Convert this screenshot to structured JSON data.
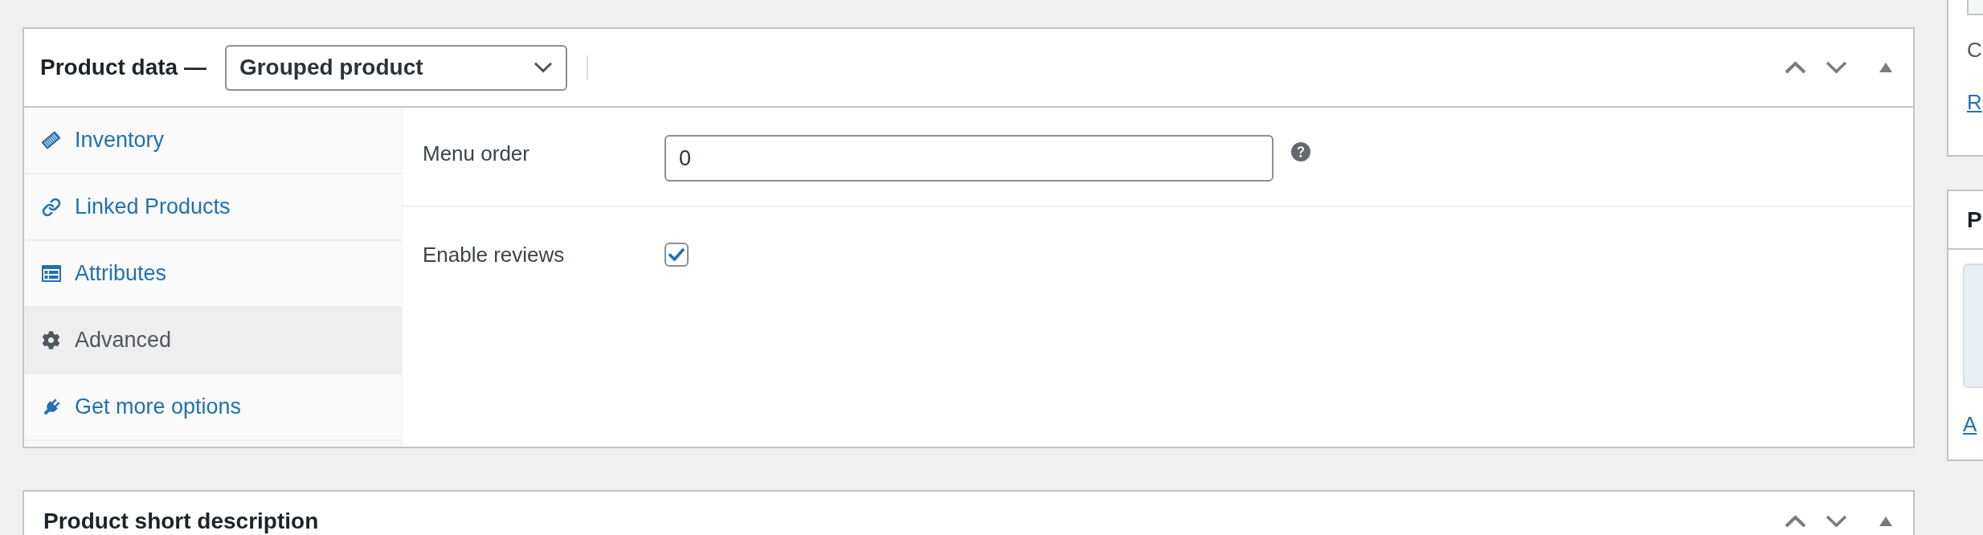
{
  "product_data": {
    "title": "Product data —",
    "product_type": "Grouped product",
    "tabs": [
      {
        "label": "Inventory",
        "selected": false
      },
      {
        "label": "Linked Products",
        "selected": false
      },
      {
        "label": "Attributes",
        "selected": false
      },
      {
        "label": "Advanced",
        "selected": true
      },
      {
        "label": "Get more options",
        "selected": false
      }
    ],
    "fields": [
      {
        "kind": "text",
        "label": "Menu order",
        "value": "0"
      },
      {
        "kind": "checkbox",
        "label": "Enable reviews",
        "checked": true
      }
    ]
  },
  "short_description": {
    "title": "Product short description"
  },
  "side_panels": [
    {
      "kind": "form",
      "text": "C",
      "link": "R"
    },
    {
      "kind": "media",
      "title": "P",
      "link": "A"
    }
  ]
}
